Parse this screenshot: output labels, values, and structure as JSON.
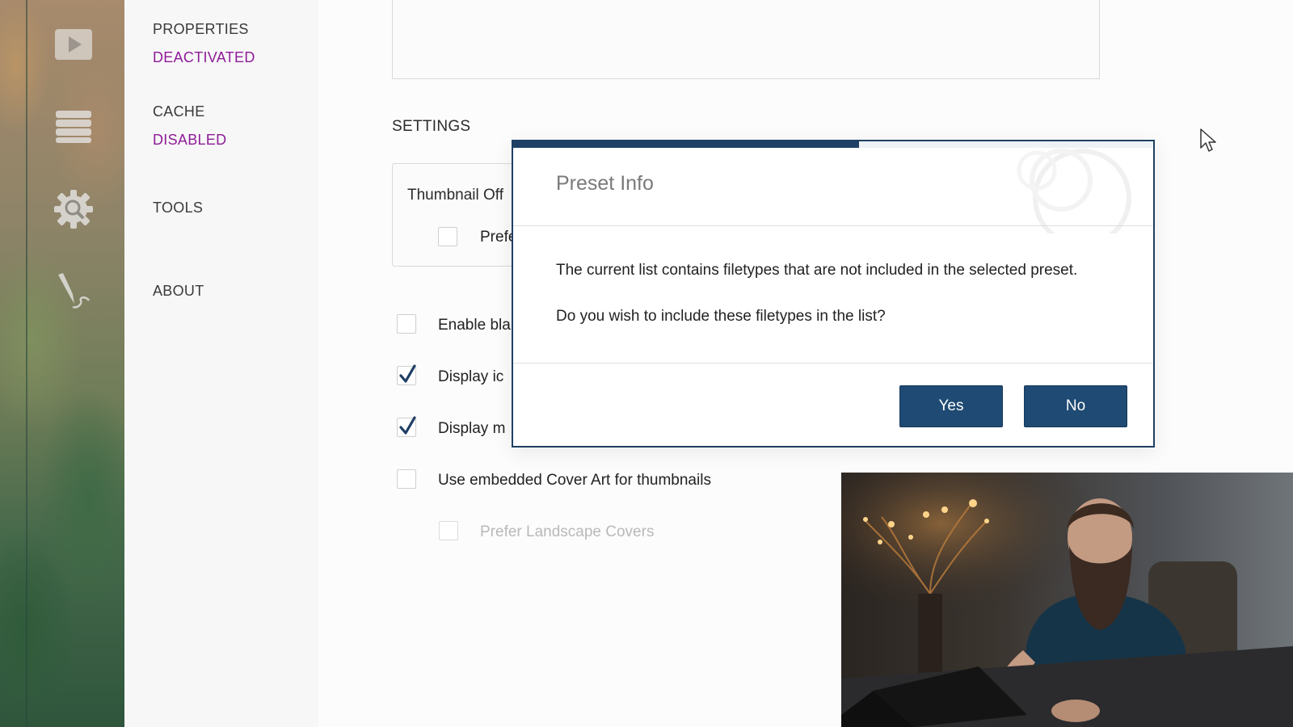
{
  "rail": {
    "icons": [
      "play-icon",
      "stack-icon",
      "gear-search-icon",
      "pen-signature-icon"
    ]
  },
  "nav": {
    "items": [
      {
        "title": "PROPERTIES",
        "status": "DEACTIVATED"
      },
      {
        "title": "CACHE",
        "status": "DISABLED"
      },
      {
        "title": "TOOLS"
      },
      {
        "title": "ABOUT"
      }
    ],
    "status_color": "#8e1c98"
  },
  "settings": {
    "heading": "SETTINGS",
    "thumbnail_offset_label": "Thumbnail Off",
    "prefer_partial_label": "Prefe",
    "options": [
      {
        "label": "Enable bla",
        "checked": false
      },
      {
        "label": "Display ic",
        "checked": true
      },
      {
        "label": "Display m",
        "checked": true
      },
      {
        "label": "Use embedded Cover Art for thumbnails",
        "checked": false
      },
      {
        "label": "Prefer Landscape Covers",
        "checked": false,
        "disabled": true
      }
    ]
  },
  "dialog": {
    "title": "Preset Info",
    "message_line1": "The current list contains filetypes that are not included in the selected preset.",
    "message_line2": "Do you wish to include these filetypes in the list?",
    "yes_label": "Yes",
    "no_label": "No",
    "progress": 0.54,
    "accent": "#1f3f64"
  },
  "webcam": {
    "kind": "presenter-video-overlay"
  }
}
